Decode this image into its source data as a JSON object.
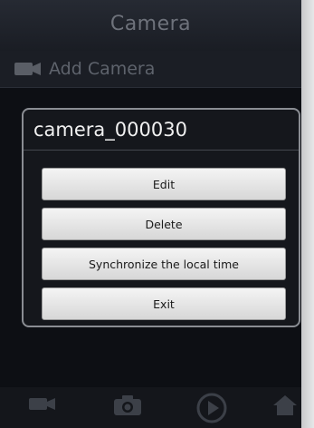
{
  "app": {
    "title": "Camera"
  },
  "add_row": {
    "label": "Add Camera",
    "icon": "video-camera-icon"
  },
  "dialog": {
    "title": "camera_000030",
    "buttons": [
      "Edit",
      "Delete",
      "Synchronize the local time",
      "Exit"
    ]
  },
  "bottom_tabs": [
    "video-camera-icon",
    "photo-camera-icon",
    "play-icon",
    "home-icon"
  ]
}
